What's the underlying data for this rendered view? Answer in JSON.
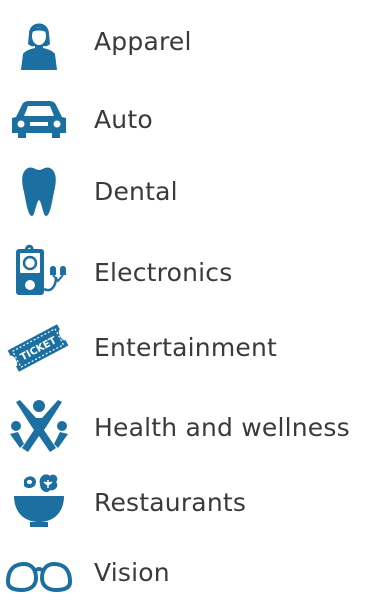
{
  "theme": {
    "icon_color": "#1b6fa1",
    "text_color": "#3a3a3a"
  },
  "categories": [
    {
      "label": "Apparel",
      "icon": "woman-icon"
    },
    {
      "label": "Auto",
      "icon": "car-icon"
    },
    {
      "label": "Dental",
      "icon": "tooth-icon"
    },
    {
      "label": "Electronics",
      "icon": "media-player-icon"
    },
    {
      "label": "Entertainment",
      "icon": "ticket-icon",
      "icon_text": "TICKET"
    },
    {
      "label": "Health and wellness",
      "icon": "fitness-person-icon"
    },
    {
      "label": "Restaurants",
      "icon": "food-bowl-icon"
    },
    {
      "label": "Vision",
      "icon": "eyeglasses-icon"
    }
  ]
}
